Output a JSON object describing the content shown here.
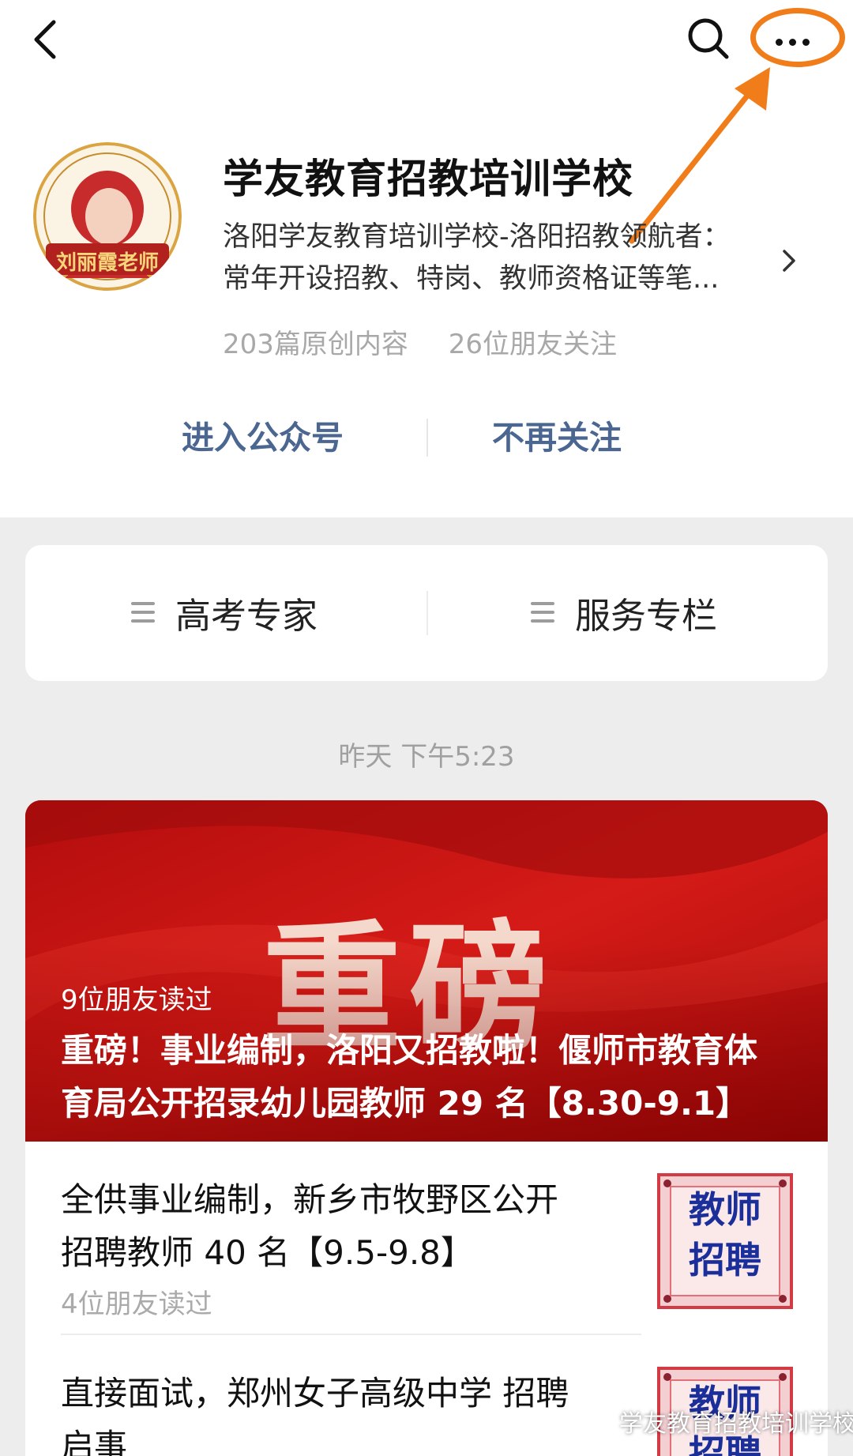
{
  "nav": {
    "back_icon": "chevron-left-icon",
    "search_icon": "search-icon",
    "more_icon": "more-dots-icon",
    "highlight_color": "#f07c1a"
  },
  "account": {
    "avatar_caption": "刘丽霞老师",
    "name": "学友教育招教培训学校",
    "description_lines": [
      "洛阳学友教育培训学校-洛阳招教领航者：",
      "常年开设招教、特岗、教师资格证等笔..."
    ],
    "original_count": "203篇原创内容",
    "friends_following": "26位朋友关注",
    "enter_button": "进入公众号",
    "unfollow_button": "不再关注",
    "action_color": "#4a6691"
  },
  "menu": {
    "items": [
      {
        "label": "高考专家",
        "icon": "menu-lines-icon"
      },
      {
        "label": "服务专栏",
        "icon": "menu-lines-icon"
      }
    ]
  },
  "timestamp": "昨天 下午5:23",
  "featured": {
    "image_text": "重磅",
    "reads": "9位朋友读过",
    "title_lines": [
      "重磅！事业编制，洛阳又招教啦！偃师市教育体",
      "育局公开招录幼儿园教师 29 名【8.30-9.1】"
    ]
  },
  "articles": [
    {
      "title_lines": [
        "全供事业编制，新乡市牧野区公开",
        "招聘教师 40 名【9.5-9.8】"
      ],
      "reads": "4位朋友读过",
      "thumb_lines": [
        "教师",
        "招聘"
      ]
    },
    {
      "title_lines": [
        "直接面试，郑州女子高级中学 招聘",
        "启事"
      ],
      "reads": "",
      "thumb_lines": [
        "教师",
        "招聘"
      ]
    }
  ],
  "watermark": "学友教育招教培训学校"
}
